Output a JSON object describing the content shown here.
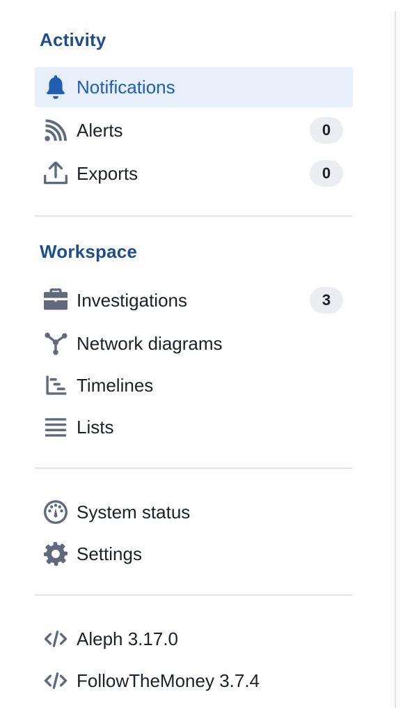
{
  "colors": {
    "accent": "#1f4e8c",
    "active_bg": "#e6effa",
    "active_text": "#215db0",
    "icon": "#5f6b7c",
    "badge_bg": "#ebedf0"
  },
  "sidebar": {
    "activity": {
      "title": "Activity",
      "items": [
        {
          "label": "Notifications",
          "icon": "bell-icon",
          "active": true
        },
        {
          "label": "Alerts",
          "icon": "feed-icon",
          "count": "0"
        },
        {
          "label": "Exports",
          "icon": "export-icon",
          "count": "0"
        }
      ]
    },
    "workspace": {
      "title": "Workspace",
      "items": [
        {
          "label": "Investigations",
          "icon": "briefcase-icon",
          "count": "3"
        },
        {
          "label": "Network diagrams",
          "icon": "graph-icon"
        },
        {
          "label": "Timelines",
          "icon": "timeline-icon"
        },
        {
          "label": "Lists",
          "icon": "list-icon"
        }
      ]
    },
    "system": {
      "items": [
        {
          "label": "System status",
          "icon": "dashboard-icon"
        },
        {
          "label": "Settings",
          "icon": "gear-icon"
        }
      ]
    },
    "versions": {
      "items": [
        {
          "label": "Aleph 3.17.0",
          "icon": "code-icon"
        },
        {
          "label": "FollowTheMoney 3.7.4",
          "icon": "code-icon"
        }
      ]
    }
  }
}
